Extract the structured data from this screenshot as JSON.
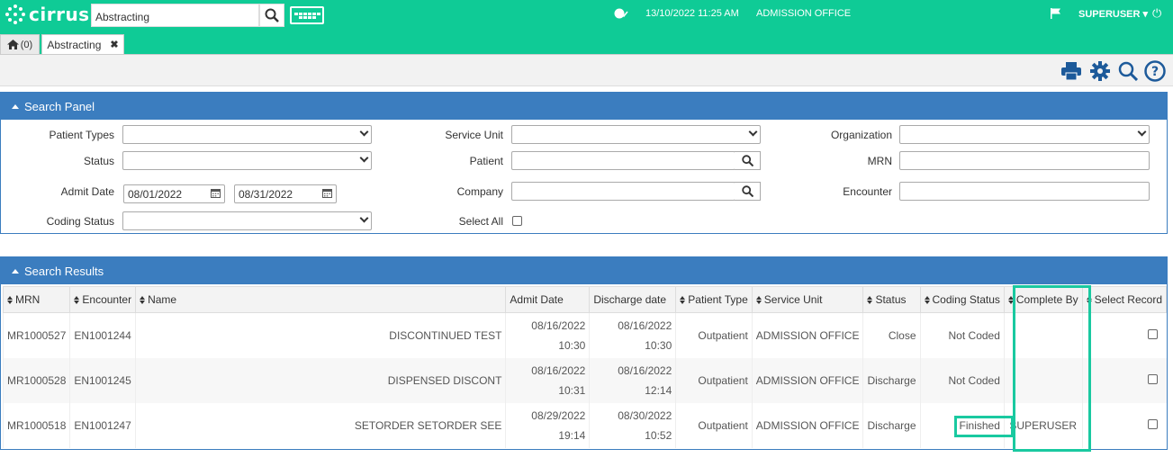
{
  "header": {
    "logo_text": "cirrus",
    "search_value": "Abstracting",
    "datetime": "13/10/2022 11:25 AM",
    "office": "ADMISSION OFFICE",
    "user": "SUPERUSER",
    "colors": {
      "brand": "#0fcb96",
      "panel": "#3b7dbf"
    }
  },
  "tabs": {
    "home_label": "(0)",
    "active_label": "Abstracting"
  },
  "search_panel": {
    "title": "Search Panel",
    "patient_types_label": "Patient Types",
    "status_label": "Status",
    "admit_date_label": "Admit Date",
    "admit_from": "08/01/2022",
    "admit_to": "08/31/2022",
    "coding_status_label": "Coding Status",
    "service_unit_label": "Service Unit",
    "patient_label": "Patient",
    "company_label": "Company",
    "select_all_label": "Select All",
    "organization_label": "Organization",
    "mrn_label": "MRN",
    "encounter_label": "Encounter"
  },
  "results": {
    "title": "Search Results",
    "columns": [
      "MRN",
      "Encounter",
      "Name",
      "Admit Date",
      "Discharge date",
      "Patient Type",
      "Service Unit",
      "Status",
      "Coding Status",
      "Complete By",
      "Select Record"
    ],
    "rows": [
      {
        "mrn": "MR1000527",
        "encounter": "EN1001244",
        "name": "DISCONTINUED TEST",
        "admit_date": "08/16/2022",
        "admit_time": "10:30",
        "discharge_date": "08/16/2022",
        "discharge_time": "10:30",
        "patient_type": "Outpatient",
        "service_unit": "ADMISSION OFFICE",
        "status": "Close",
        "coding_status": "Not Coded",
        "complete_by": ""
      },
      {
        "mrn": "MR1000528",
        "encounter": "EN1001245",
        "name": "DISPENSED DISCONT",
        "admit_date": "08/16/2022",
        "admit_time": "10:31",
        "discharge_date": "08/16/2022",
        "discharge_time": "12:14",
        "patient_type": "Outpatient",
        "service_unit": "ADMISSION OFFICE",
        "status": "Discharge",
        "coding_status": "Not Coded",
        "complete_by": ""
      },
      {
        "mrn": "MR1000518",
        "encounter": "EN1001247",
        "name": "SETORDER SETORDER SEE",
        "admit_date": "08/29/2022",
        "admit_time": "19:14",
        "discharge_date": "08/30/2022",
        "discharge_time": "10:52",
        "patient_type": "Outpatient",
        "service_unit": "ADMISSION OFFICE",
        "status": "Discharge",
        "coding_status": "Finished",
        "complete_by": "SUPERUSER"
      }
    ]
  }
}
